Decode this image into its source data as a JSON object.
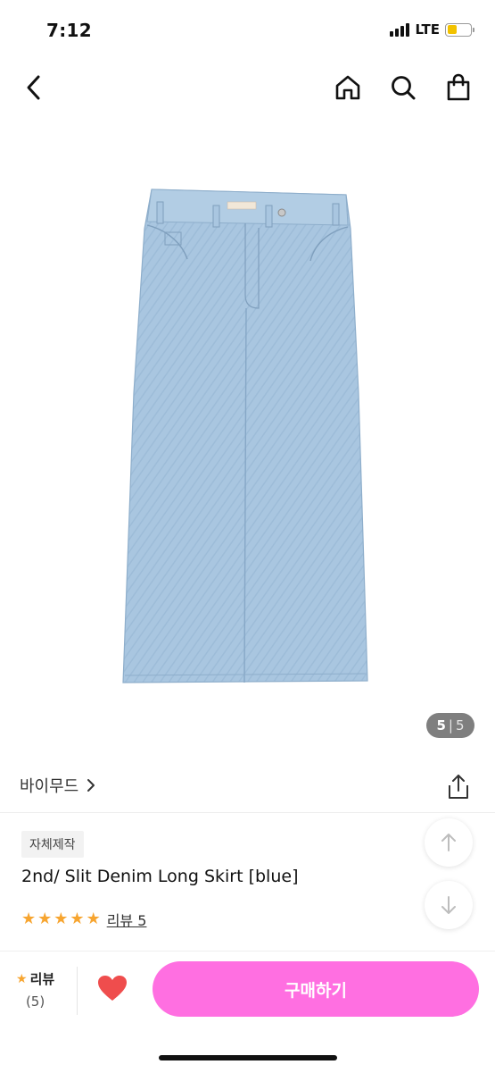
{
  "status_bar": {
    "time": "7:12",
    "network": "LTE",
    "battery_level": 0.45,
    "battery_color": "#f2c200"
  },
  "nav": {
    "icons": [
      "back-icon",
      "home-icon",
      "search-icon",
      "shopping-bag-icon"
    ]
  },
  "product": {
    "image_icon": "denim-skirt-image",
    "image_counter": {
      "current": "5",
      "separator": "|",
      "total": "5"
    },
    "brand": "바이무드",
    "tag": "자체제작",
    "title": "2nd/ Slit Denim Long Skirt [blue]",
    "rating": {
      "stars": 5,
      "review_label": "리뷰 5"
    }
  },
  "bottom_bar": {
    "review_label": "리뷰",
    "review_count": "(5)",
    "buy_label": "구매하기",
    "buy_color": "#ff6fe1",
    "heart_color": "#ef4d4d"
  },
  "colors": {
    "star": "#f7a530",
    "denim": "#a9c6e0"
  }
}
